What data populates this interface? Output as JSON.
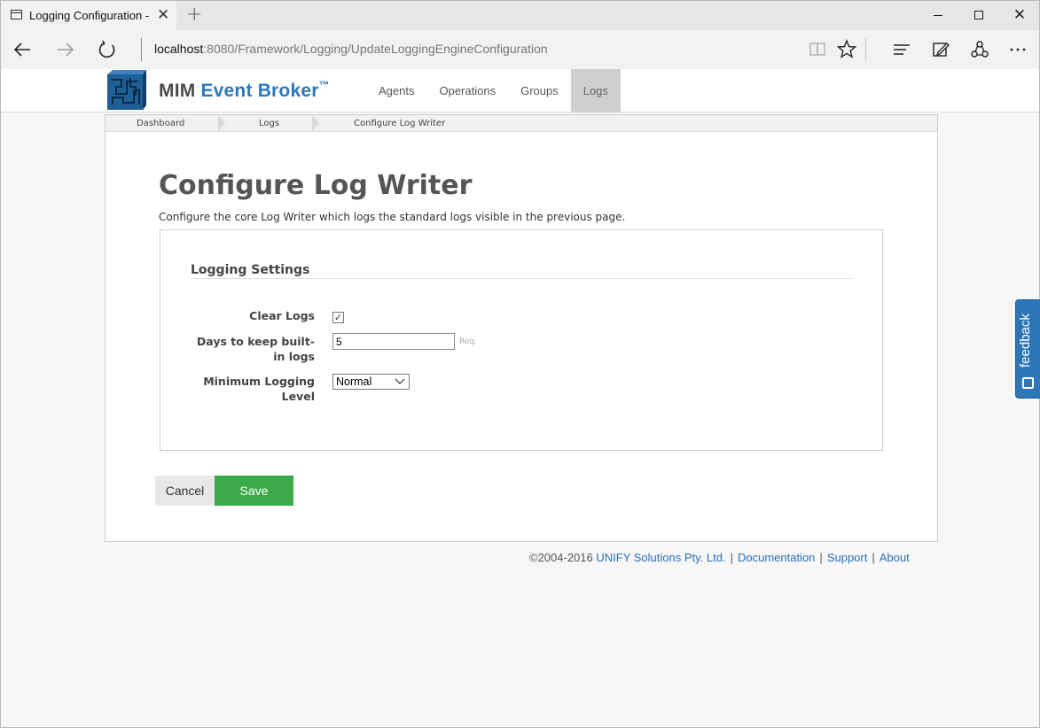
{
  "browser": {
    "tab_title": "Logging Configuration -",
    "new_tab_glyph": "+",
    "address_host": "localhost",
    "address_path": ":8080/Framework/Logging/UpdateLoggingEngineConfiguration"
  },
  "header": {
    "logo_text_1": "MIM",
    "logo_text_2": "Event Broker",
    "logo_tm": "™",
    "nav": [
      {
        "label": "Agents"
      },
      {
        "label": "Operations"
      },
      {
        "label": "Groups"
      },
      {
        "label": "Logs",
        "active": true
      }
    ]
  },
  "breadcrumb": [
    "Dashboard",
    "Logs",
    "Configure Log Writer"
  ],
  "main": {
    "title": "Configure Log Writer",
    "description": "Configure the core Log Writer which logs the standard logs visible in the previous page.",
    "section_title": "Logging Settings",
    "fields": {
      "clear_logs_label": "Clear Logs",
      "clear_logs_checked": true,
      "days_label_1": "Days to keep built-",
      "days_label_2": "in logs",
      "days_value": "5",
      "days_hint": "Req.",
      "min_level_label_1": "Minimum Logging",
      "min_level_label_2": "Level",
      "min_level_value": "Normal"
    },
    "cancel_label": "Cancel",
    "save_label": "Save"
  },
  "footer": {
    "copyright": "©2004-2016",
    "company": "UNIFY Solutions Pty. Ltd.",
    "documentation": "Documentation",
    "support": "Support",
    "about": "About",
    "separator": "|"
  },
  "feedback_label": "feedback",
  "colors": {
    "accent": "#2e77b7",
    "save_button": "#3bab4a",
    "active_nav": "#cfcfcf"
  }
}
